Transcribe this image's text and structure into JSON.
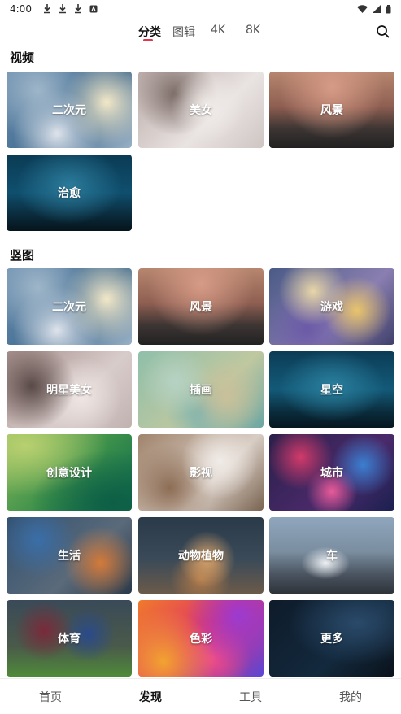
{
  "status_bar": {
    "time": "4:00",
    "left_icons": [
      "download-icon",
      "download-icon",
      "download-icon",
      "app-notification-icon"
    ],
    "right_icons": [
      "wifi-icon",
      "signal-icon",
      "battery-icon"
    ]
  },
  "top_tabs": {
    "items": [
      {
        "label": "分类",
        "active": true
      },
      {
        "label": "图辑",
        "active": false
      },
      {
        "label": "4K",
        "active": false
      },
      {
        "label": "8K",
        "active": false
      }
    ],
    "search_icon": "search-icon",
    "accent_color": "#e8344a"
  },
  "sections": [
    {
      "title": "视频",
      "tiles": [
        "二次元",
        "美女",
        "风景",
        "治愈"
      ]
    },
    {
      "title": "竖图",
      "tiles": [
        "二次元",
        "风景",
        "游戏",
        "明星美女",
        "插画",
        "星空",
        "创意设计",
        "影视",
        "城市",
        "生活",
        "动物植物",
        "车",
        "体育",
        "色彩",
        "更多"
      ]
    }
  ],
  "bottom_nav": {
    "items": [
      {
        "label": "首页",
        "active": false
      },
      {
        "label": "发现",
        "active": true
      },
      {
        "label": "工具",
        "active": false
      },
      {
        "label": "我的",
        "active": false
      }
    ]
  }
}
